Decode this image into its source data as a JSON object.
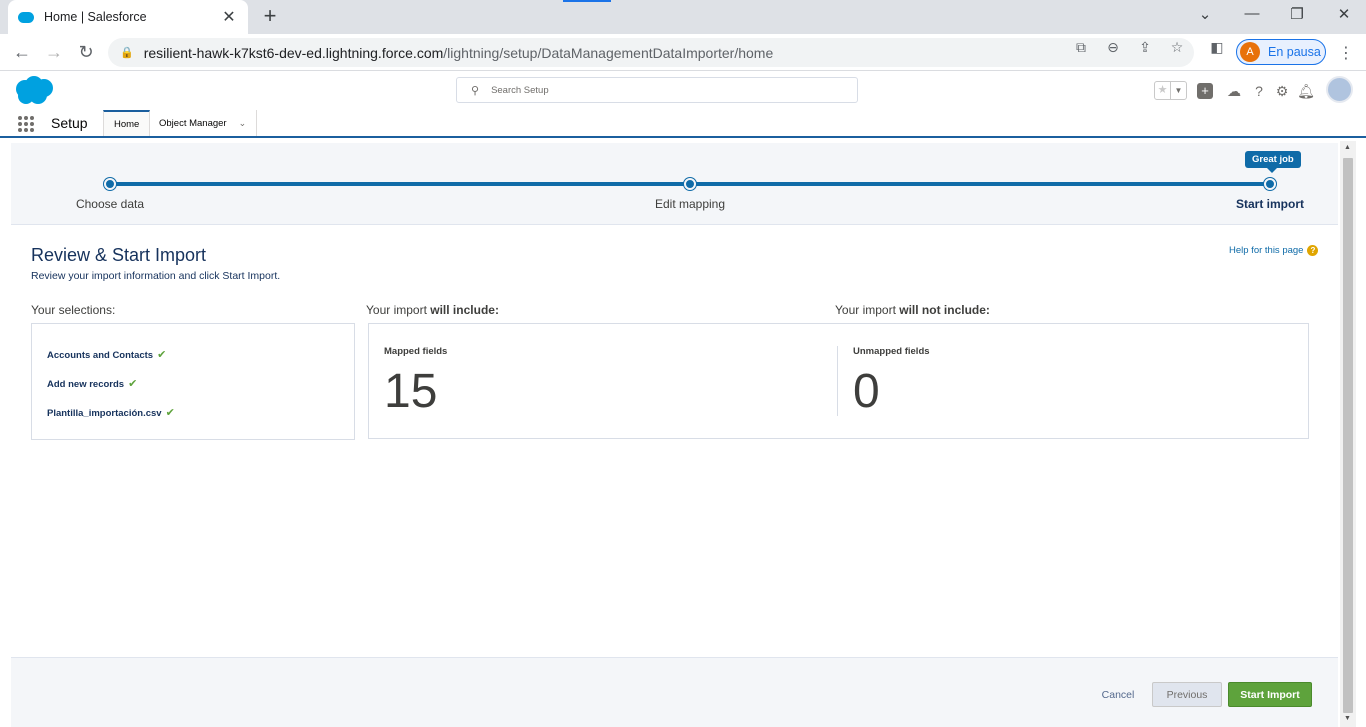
{
  "browser": {
    "tab_title": "Home | Salesforce",
    "url_host": "resilient-hawk-k7kst6-dev-ed.lightning.force.com",
    "url_path": "/lightning/setup/DataManagementDataImporter/home",
    "profile_initial": "A",
    "profile_label": "En pausa"
  },
  "header": {
    "search_placeholder": "Search Setup"
  },
  "subnav": {
    "app_name": "Setup",
    "tabs": [
      {
        "label": "Home"
      },
      {
        "label": "Object Manager"
      }
    ]
  },
  "progress": {
    "steps": [
      {
        "label": "Choose data"
      },
      {
        "label": "Edit mapping"
      },
      {
        "label": "Start import"
      }
    ],
    "tooltip": "Great job"
  },
  "page": {
    "title": "Review & Start Import",
    "subtitle": "Review your import information and click Start Import.",
    "help_link": "Help for this page"
  },
  "selections": {
    "heading": "Your selections:",
    "items": [
      "Accounts and Contacts",
      "Add new records",
      "Plantilla_importación.csv"
    ]
  },
  "include": {
    "heading_prefix": "Your import ",
    "heading_bold": "will include:",
    "mapped_label": "Mapped fields",
    "mapped_count": "15"
  },
  "exclude": {
    "heading_prefix": "Your import ",
    "heading_bold": "will not include:",
    "unmapped_label": "Unmapped fields",
    "unmapped_count": "0"
  },
  "footer": {
    "cancel": "Cancel",
    "previous": "Previous",
    "start": "Start Import"
  },
  "colors": {
    "brand_blue": "#0f6ba8",
    "start_green": "#5ea33c"
  }
}
